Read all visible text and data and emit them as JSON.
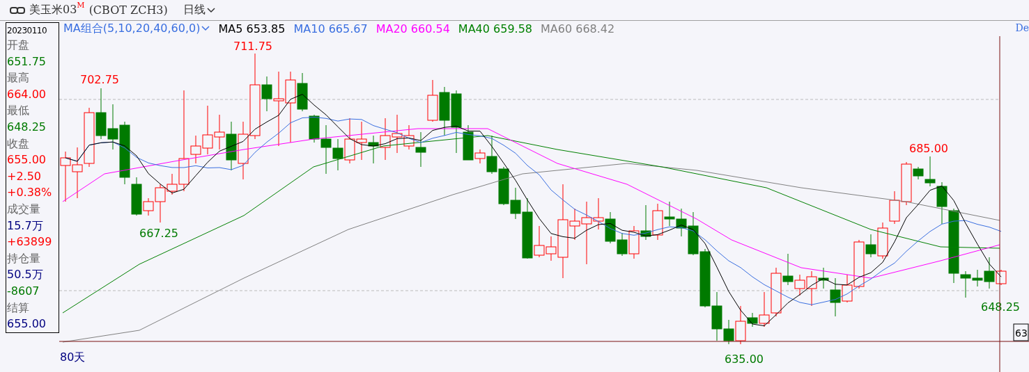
{
  "header": {
    "title": "美玉米03",
    "title_mark": "M",
    "code": "(CBOT  ZCH3)",
    "period": "日线"
  },
  "legend": {
    "group": "MA组合(5,10,20,40,60,0)",
    "items": [
      {
        "label": "MA5 653.85",
        "color": "#000000"
      },
      {
        "label": "MA10 665.67",
        "color": "#3a6fe0"
      },
      {
        "label": "MA20 660.54",
        "color": "#ff00ff"
      },
      {
        "label": "MA40 659.58",
        "color": "#008000"
      },
      {
        "label": "MA60 668.42",
        "color": "#808080"
      }
    ]
  },
  "info_panel": {
    "items": [
      {
        "kind": "date",
        "text": "20230110"
      },
      {
        "kind": "label",
        "text": "开盘"
      },
      {
        "kind": "value",
        "text": "651.75",
        "color": "#007a00"
      },
      {
        "kind": "label",
        "text": "最高"
      },
      {
        "kind": "value",
        "text": "664.00",
        "color": "#ff0000"
      },
      {
        "kind": "label",
        "text": "最低"
      },
      {
        "kind": "value",
        "text": "648.25",
        "color": "#007a00"
      },
      {
        "kind": "label",
        "text": "收盘"
      },
      {
        "kind": "value",
        "text": "655.00",
        "color": "#ff0000"
      },
      {
        "kind": "value",
        "text": "+2.50",
        "color": "#ff0000"
      },
      {
        "kind": "value",
        "text": "+0.38%",
        "color": "#ff0000"
      },
      {
        "kind": "label",
        "text": "成交量"
      },
      {
        "kind": "value",
        "text": "15.7万",
        "color": "#000080"
      },
      {
        "kind": "value",
        "text": "+63899",
        "color": "#ff0000"
      },
      {
        "kind": "label",
        "text": "持仓量"
      },
      {
        "kind": "value",
        "text": "50.5万",
        "color": "#000080"
      },
      {
        "kind": "value",
        "text": "-8607",
        "color": "#007a00"
      },
      {
        "kind": "label",
        "text": "结算"
      },
      {
        "kind": "value",
        "text": "655.00",
        "color": "#000080"
      }
    ]
  },
  "chart": {
    "annotations": [
      {
        "text": "711.75",
        "kind": "high"
      },
      {
        "text": "702.75",
        "kind": "high"
      },
      {
        "text": "667.25",
        "kind": "low"
      },
      {
        "text": "685.00",
        "kind": "high"
      },
      {
        "text": "635.00",
        "kind": "low"
      },
      {
        "text": "648.25",
        "kind": "low"
      }
    ],
    "axis_label": "80天",
    "price_tag": "63",
    "right_label": "De"
  }
}
